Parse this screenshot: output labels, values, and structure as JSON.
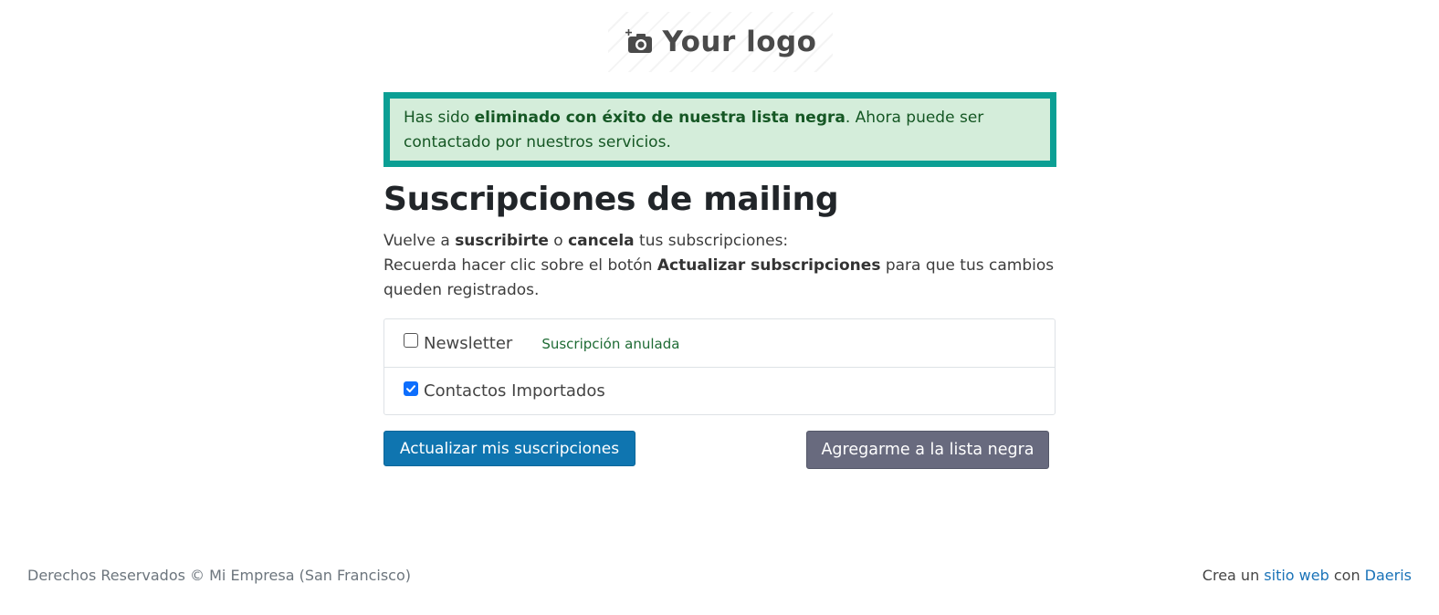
{
  "logo": {
    "text": "Your logo",
    "icon": "camera-plus-icon"
  },
  "alert": {
    "prefix": "Has sido ",
    "strong": "eliminado con éxito de nuestra lista negra",
    "suffix": ". Ahora puede ser contactado por nuestros servicios.",
    "border_color": "#0b9f94",
    "background_color": "#d4edda"
  },
  "page": {
    "title": "Suscripciones de mailing",
    "intro": {
      "line1_a": "Vuelve a ",
      "line1_b": "suscribirte",
      "line1_c": " o ",
      "line1_d": "cancela",
      "line1_e": " tus subscripciones:",
      "line2_a": "Recuerda hacer clic sobre el botón ",
      "line2_b": "Actualizar subscripciones",
      "line2_c": " para que tus cambios queden registrados."
    }
  },
  "subscriptions": [
    {
      "label": "Newsletter",
      "checked": false,
      "status": "Suscripción anulada"
    },
    {
      "label": "Contactos Importados",
      "checked": true,
      "status": ""
    }
  ],
  "buttons": {
    "update_label": "Actualizar mis suscripciones",
    "blacklist_label": "Agregarme a la lista negra",
    "primary_color": "#0f75b0",
    "secondary_color": "#686a7e"
  },
  "footer": {
    "copyright": "Derechos Reservados © Mi Empresa (San Francisco)",
    "credit_prefix": "Crea un ",
    "credit_link1": "sitio web",
    "credit_middle": " con ",
    "credit_link2": "Daeris",
    "link_color": "#1a73b8"
  }
}
